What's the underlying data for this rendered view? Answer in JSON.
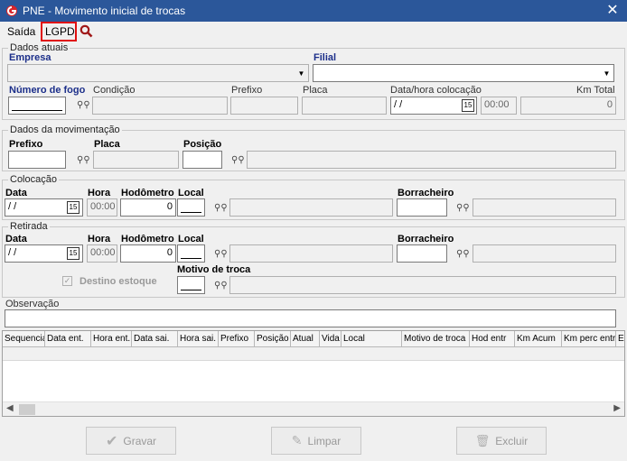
{
  "window": {
    "title": "PNE - Movimento inicial de trocas",
    "close": "✕"
  },
  "menu": {
    "saida": "Saída",
    "lgpd": "LGPD"
  },
  "dados_atuais": {
    "legend": "Dados atuais",
    "empresa_label": "Empresa",
    "filial_label": "Filial",
    "numero_fogo_label": "Número de fogo",
    "condicao_label": "Condição",
    "prefixo_label": "Prefixo",
    "placa_label": "Placa",
    "data_hora_label": "Data/hora colocação",
    "data_value": "/ /",
    "hora_value": "00:00",
    "km_total_label": "Km Total",
    "km_total_value": "0"
  },
  "dados_movimentacao": {
    "legend": "Dados da movimentação",
    "prefixo_label": "Prefixo",
    "placa_label": "Placa",
    "posicao_label": "Posição"
  },
  "colocacao": {
    "legend": "Colocação",
    "data_label": "Data",
    "hora_label": "Hora",
    "hodometro_label": "Hodômetro",
    "local_label": "Local",
    "borracheiro_label": "Borracheiro",
    "data_value": "/ /",
    "hora_value": "00:00",
    "hodometro_value": "0"
  },
  "retirada": {
    "legend": "Retirada",
    "data_label": "Data",
    "hora_label": "Hora",
    "hodometro_label": "Hodômetro",
    "local_label": "Local",
    "borracheiro_label": "Borracheiro",
    "data_value": "/ /",
    "hora_value": "00:00",
    "hodometro_value": "0",
    "destino_estoque_label": "Destino estoque",
    "motivo_troca_label": "Motivo de troca"
  },
  "observacao_label": "Observação",
  "grid": {
    "columns": [
      "Sequencia",
      "Data ent.",
      "Hora ent.",
      "Data sai.",
      "Hora sai.",
      "Prefixo",
      "Posição",
      "Atual",
      "Vida",
      "Local",
      "Motivo de troca",
      "Hod entr",
      "Km Acum",
      "Km perc entr",
      "E"
    ]
  },
  "buttons": {
    "gravar": "Gravar",
    "limpar": "Limpar",
    "excluir": "Excluir"
  },
  "colors": {
    "titlebar": "#2b579a",
    "highlight": "#e01010",
    "label_blue": "#1c2f8a"
  }
}
